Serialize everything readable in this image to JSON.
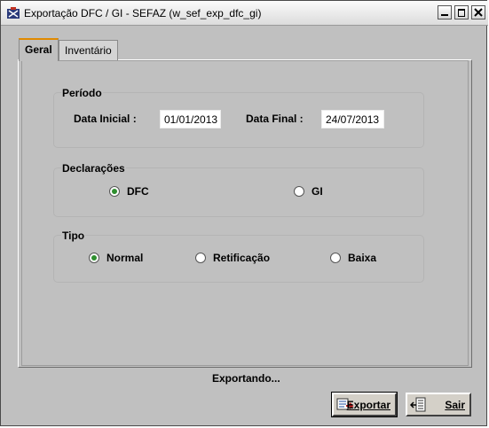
{
  "window": {
    "title": "Exportação DFC / GI - SEFAZ (w_sef_exp_dfc_gi)"
  },
  "tabs": [
    {
      "label": "Geral",
      "selected": true
    },
    {
      "label": "Inventário",
      "selected": false
    }
  ],
  "periodo": {
    "title": "Período",
    "data_inicial_label": "Data Inicial  :",
    "data_inicial_value": "01/01/2013",
    "data_final_label": "Data Final :",
    "data_final_value": "24/07/2013"
  },
  "declaracoes": {
    "title": "Declarações",
    "options": [
      {
        "label": "DFC",
        "checked": true
      },
      {
        "label": "GI",
        "checked": false
      }
    ]
  },
  "tipo": {
    "title": "Tipo",
    "options": [
      {
        "label": "Normal",
        "checked": true
      },
      {
        "label": "Retificação",
        "checked": false
      },
      {
        "label": "Baixa",
        "checked": false
      }
    ]
  },
  "status": {
    "text": "Exportando..."
  },
  "buttons": {
    "exportar_label": "Exportar",
    "sair_label": "Sair"
  },
  "colors": {
    "background": "#c0c0c0",
    "radio_checked": "#2f8f2f",
    "tab_accent": "#e08a00"
  },
  "icons": [
    "app-icon",
    "minimize-icon",
    "maximize-icon",
    "close-icon",
    "export-icon",
    "exit-icon"
  ]
}
